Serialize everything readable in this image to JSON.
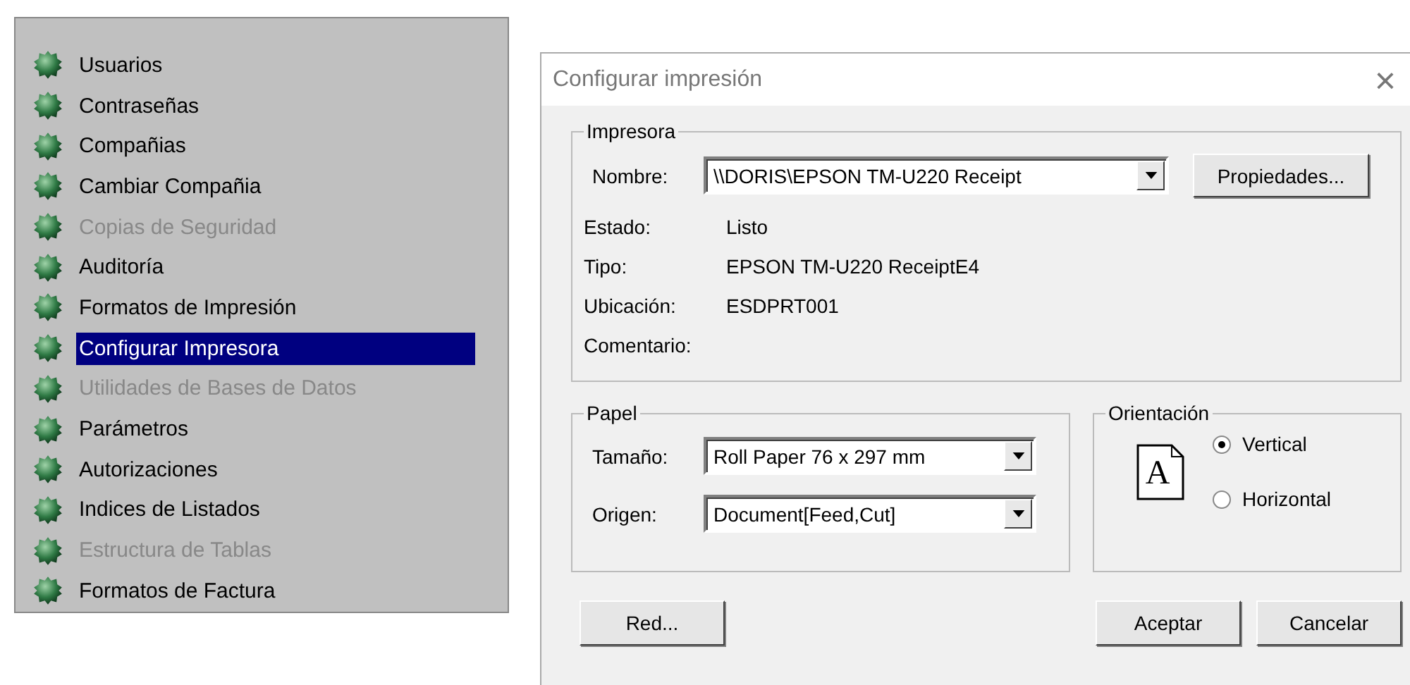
{
  "menu": {
    "items": [
      {
        "label": "Usuarios",
        "disabled": false,
        "selected": false
      },
      {
        "label": "Contraseñas",
        "disabled": false,
        "selected": false
      },
      {
        "label": "Compañias",
        "disabled": false,
        "selected": false
      },
      {
        "label": "Cambiar Compañia",
        "disabled": false,
        "selected": false
      },
      {
        "label": "Copias de Seguridad",
        "disabled": true,
        "selected": false
      },
      {
        "label": "Auditoría",
        "disabled": false,
        "selected": false
      },
      {
        "label": "Formatos de Impresión",
        "disabled": false,
        "selected": false
      },
      {
        "label": "Configurar Impresora",
        "disabled": false,
        "selected": true
      },
      {
        "label": "Utilidades de Bases de Datos",
        "disabled": true,
        "selected": false
      },
      {
        "label": "Parámetros",
        "disabled": false,
        "selected": false
      },
      {
        "label": "Autorizaciones",
        "disabled": false,
        "selected": false
      },
      {
        "label": "Indices de Listados",
        "disabled": false,
        "selected": false
      },
      {
        "label": "Estructura de Tablas",
        "disabled": true,
        "selected": false
      },
      {
        "label": "Formatos de Factura",
        "disabled": false,
        "selected": false
      }
    ]
  },
  "dialog": {
    "title": "Configurar impresión",
    "close": "×",
    "printer": {
      "legend": "Impresora",
      "name_label": "Nombre:",
      "name_value": "\\\\DORIS\\EPSON TM-U220 Receipt",
      "properties_button": "Propiedades...",
      "info": [
        {
          "label": "Estado:",
          "value": "Listo"
        },
        {
          "label": "Tipo:",
          "value": "EPSON TM-U220 ReceiptE4"
        },
        {
          "label": "Ubicación:",
          "value": "ESDPRT001"
        },
        {
          "label": "Comentario:"
        }
      ]
    },
    "paper": {
      "legend": "Papel",
      "fields": [
        {
          "label": "Tamaño:",
          "value": "Roll Paper 76 x 297 mm"
        },
        {
          "label": "Origen:",
          "value": "Document[Feed,Cut]"
        }
      ]
    },
    "orientation": {
      "legend": "Orientación",
      "icon_letter": "A",
      "options": [
        {
          "label": "Vertical",
          "selected": true
        },
        {
          "label": "Horizontal",
          "selected": false
        }
      ]
    },
    "buttons": {
      "left": [
        "Red..."
      ],
      "right": [
        "Aceptar",
        "Cancelar"
      ]
    }
  }
}
